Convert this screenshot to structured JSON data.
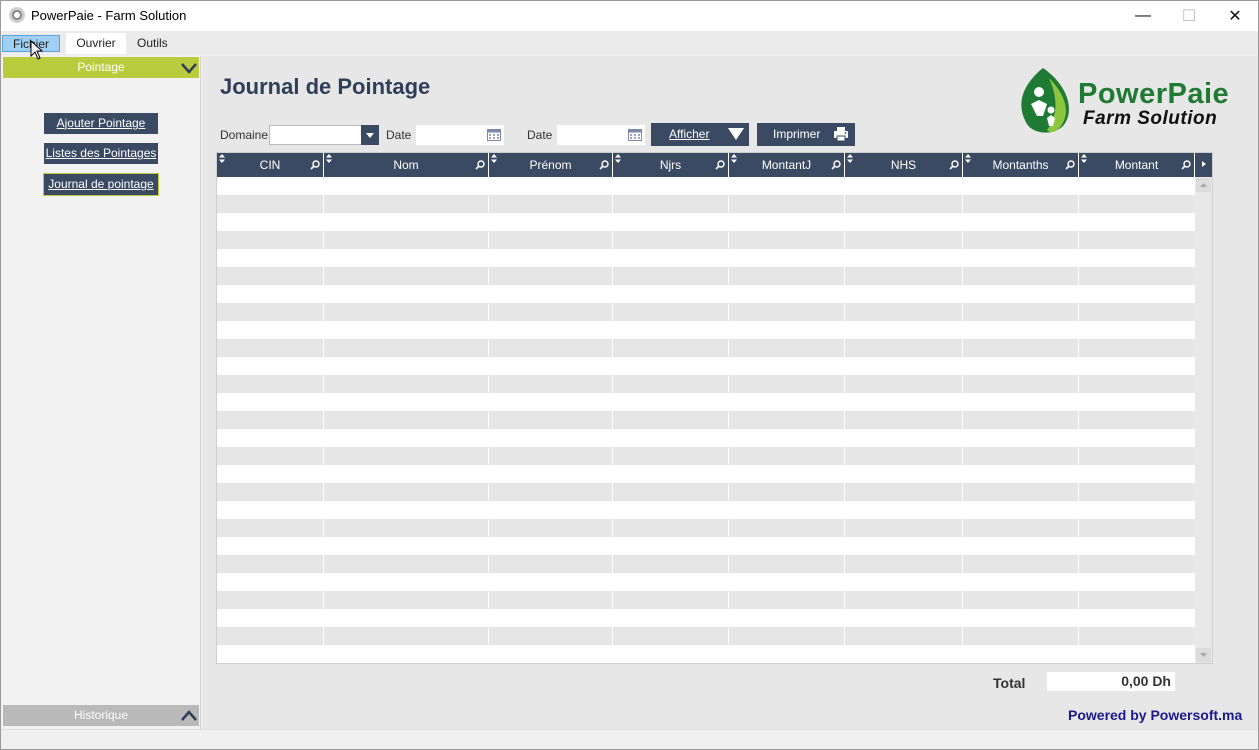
{
  "window": {
    "title": "PowerPaie - Farm Solution",
    "controls": {
      "minimize": "—",
      "maximize": "☐",
      "close": "✕"
    }
  },
  "menubar": {
    "items": [
      {
        "label": "Fichier"
      },
      {
        "label": "Ouvrier"
      },
      {
        "label": "Outils"
      }
    ]
  },
  "sidebar": {
    "section_open": "Pointage",
    "buttons": [
      {
        "label": "Ajouter Pointage"
      },
      {
        "label": "Listes des Pointages"
      },
      {
        "label": "Journal de pointage"
      }
    ],
    "section_closed": "Historique"
  },
  "main": {
    "title": "Journal de Pointage",
    "logo": {
      "name": "PowerPaie",
      "tagline": "Farm Solution"
    },
    "filters": {
      "domaine_label": "Domaine",
      "domaine_value": "",
      "date1_label": "Date",
      "date1_value": "",
      "date2_label": "Date",
      "date2_value": ""
    },
    "buttons": {
      "afficher": "Afficher",
      "imprimer": "Imprimer"
    },
    "grid": {
      "columns": [
        "CIN",
        "Nom",
        "Prénom",
        "Njrs",
        "MontantJ",
        "NHS",
        "Montanths",
        "Montant"
      ],
      "rows": []
    },
    "total_label": "Total",
    "total_value": "0,00 Dh",
    "powered_by": "Powered by Powersoft.ma"
  },
  "colors": {
    "accent_green": "#b9cc3d",
    "navy": "#3b4a63",
    "title_navy": "#2f3e59",
    "logo_green": "#1f7a33",
    "powered_blue": "#1a1a8c"
  }
}
